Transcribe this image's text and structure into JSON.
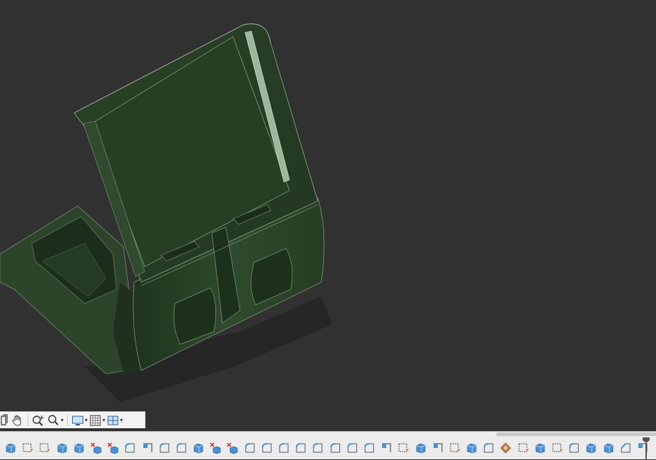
{
  "viewport": {
    "model": "phone-stand-body",
    "model_color": "#243a24",
    "background": "#313131"
  },
  "nav_toolbar": {
    "items": [
      {
        "name": "orbit-icon",
        "has_dropdown": false
      },
      {
        "name": "pan-hand-icon",
        "has_dropdown": false
      },
      {
        "name": "zoom-icon",
        "has_dropdown": false
      },
      {
        "name": "zoom-window-icon",
        "has_dropdown": true
      },
      {
        "name": "display-settings-icon",
        "has_dropdown": true
      },
      {
        "name": "grid-settings-icon",
        "has_dropdown": true
      },
      {
        "name": "viewports-icon",
        "has_dropdown": true
      }
    ],
    "caret": "▾"
  },
  "timeline": {
    "items": [
      "extrude",
      "sketch",
      "sketch",
      "extrude",
      "extrude",
      "combine-cut",
      "combine-cut",
      "fillet",
      "sketch-profile",
      "fillet",
      "fillet",
      "extrude",
      "combine-cut",
      "combine-cut",
      "fillet",
      "fillet",
      "fillet",
      "fillet",
      "fillet",
      "fillet",
      "fillet",
      "fillet",
      "sketch-profile",
      "sketch",
      "extrude",
      "sketch-profile",
      "sketch",
      "extrude",
      "fillet",
      "appearance",
      "sketch",
      "extrude",
      "sketch",
      "fillet",
      "extrude",
      "extrude",
      "chamfer",
      "sketch-profile"
    ],
    "colors": {
      "body": "#4a90d9",
      "sketch_red": "#d33a2c",
      "appearance": "#c98a4a"
    }
  }
}
